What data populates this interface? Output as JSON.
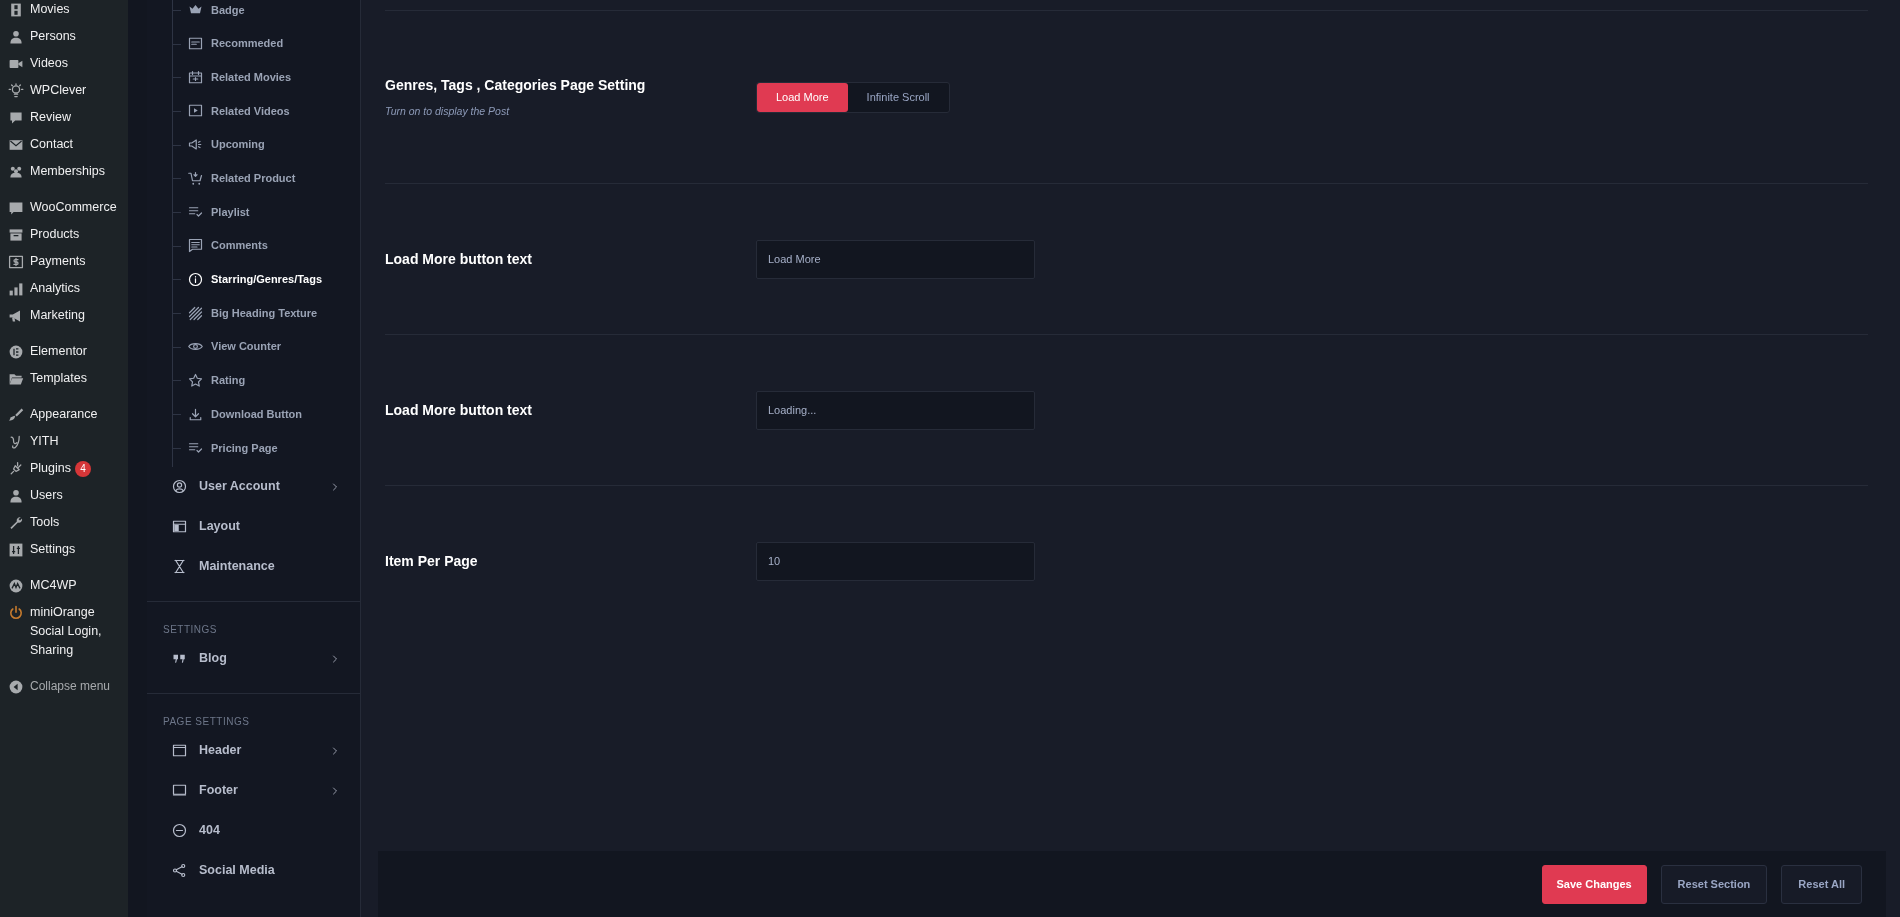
{
  "admin_menu": {
    "groups": [
      [
        {
          "label": "Movies"
        },
        {
          "label": "Persons"
        },
        {
          "label": "Videos"
        },
        {
          "label": "WPClever"
        },
        {
          "label": "Review"
        },
        {
          "label": "Contact"
        },
        {
          "label": "Memberships"
        }
      ],
      [
        {
          "label": "WooCommerce"
        },
        {
          "label": "Products"
        },
        {
          "label": "Payments"
        },
        {
          "label": "Analytics"
        },
        {
          "label": "Marketing"
        }
      ],
      [
        {
          "label": "Elementor"
        },
        {
          "label": "Templates"
        }
      ],
      [
        {
          "label": "Appearance"
        },
        {
          "label": "YITH"
        },
        {
          "label": "Plugins",
          "badge": "4"
        },
        {
          "label": "Users"
        },
        {
          "label": "Tools"
        },
        {
          "label": "Settings"
        }
      ],
      [
        {
          "label": "MC4WP"
        },
        {
          "label": "miniOrange Social Login, Sharing"
        }
      ]
    ],
    "collapse": "Collapse menu"
  },
  "options_menu": {
    "subitems": [
      {
        "label": "Badge",
        "selected": false
      },
      {
        "label": "Recommeded",
        "selected": false
      },
      {
        "label": "Related Movies",
        "selected": false
      },
      {
        "label": "Related Videos",
        "selected": false
      },
      {
        "label": "Upcoming",
        "selected": false
      },
      {
        "label": "Related Product",
        "selected": false
      },
      {
        "label": "Playlist",
        "selected": false
      },
      {
        "label": "Comments",
        "selected": false
      },
      {
        "label": "Starring/Genres/Tags",
        "selected": true
      },
      {
        "label": "Big Heading Texture",
        "selected": false
      },
      {
        "label": "View Counter",
        "selected": false
      },
      {
        "label": "Rating",
        "selected": false
      },
      {
        "label": "Download Button",
        "selected": false
      },
      {
        "label": "Pricing Page",
        "selected": false
      }
    ],
    "items": [
      {
        "label": "User Account",
        "has_submenu": true
      },
      {
        "label": "Layout",
        "has_submenu": false
      },
      {
        "label": "Maintenance",
        "has_submenu": false
      }
    ],
    "sections": [
      {
        "heading": "SETTINGS",
        "items": [
          {
            "label": "Blog",
            "has_submenu": true
          }
        ]
      },
      {
        "heading": "PAGE SETTINGS",
        "items": [
          {
            "label": "Header",
            "has_submenu": true
          },
          {
            "label": "Footer",
            "has_submenu": true
          },
          {
            "label": "404",
            "has_submenu": false
          },
          {
            "label": "Social Media",
            "has_submenu": false
          }
        ]
      }
    ]
  },
  "settings": [
    {
      "kind": "toggle",
      "title": "Genres, Tags , Categories Page Setting",
      "description": "Turn on to display the Post",
      "options": [
        {
          "label": "Load More",
          "selected": true
        },
        {
          "label": "Infinite Scroll",
          "selected": false
        }
      ]
    },
    {
      "kind": "text",
      "title": "Load More button text",
      "value": "Load More"
    },
    {
      "kind": "text",
      "title": "Load More button text",
      "value": "Loading..."
    },
    {
      "kind": "text",
      "title": "Item Per Page",
      "value": "10"
    }
  ],
  "footer_buttons": [
    {
      "label": "Save Changes",
      "kind": "primary"
    },
    {
      "label": "Reset Section",
      "kind": "secondary"
    },
    {
      "label": "Reset All",
      "kind": "secondary"
    }
  ]
}
